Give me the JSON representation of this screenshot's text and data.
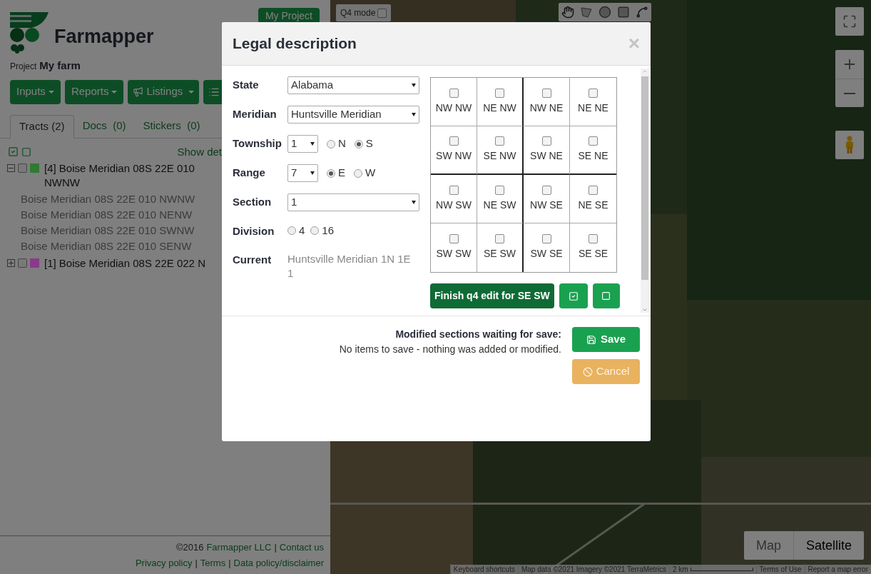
{
  "left_panel": {
    "brand": "Farmapper",
    "my_project_button": "My Project",
    "project_label": "Project",
    "project_name": "My farm",
    "toolbar": [
      {
        "label": "Inputs",
        "kind": "dropdown"
      },
      {
        "label": "Reports",
        "kind": "dropdown"
      },
      {
        "label": "Listings",
        "kind": "icon-dropdown"
      },
      {
        "kind": "icon-only"
      }
    ],
    "tabs": [
      {
        "label": "Tracts (2)",
        "selected": true
      },
      {
        "label": "Docs  (0)",
        "selected": false
      },
      {
        "label": "Stickers  (0)",
        "selected": false
      }
    ],
    "tree_toolbar": {
      "show_details": "Show det"
    },
    "tracts": [
      {
        "label": "[4] Boise Meridian 08S 22E 010 NWNW",
        "expanded": true,
        "checked": false,
        "color": "#2f7a32",
        "children": [
          {
            "label": "Boise Meridian 08S 22E 010 NWNW"
          },
          {
            "label": "Boise Meridian 08S 22E 010 NENW"
          },
          {
            "label": "Boise Meridian 08S 22E 010 SWNW"
          },
          {
            "label": "Boise Meridian 08S 22E 010 SENW"
          }
        ]
      },
      {
        "label": "[1] Boise Meridian 08S 22E 022 N",
        "expanded": false,
        "checked": false,
        "color": "#8a3a8a"
      }
    ],
    "footer": [
      [
        {
          "text": "©2016",
          "kind": "text"
        },
        {
          "text": "Farmapper LLC",
          "kind": "link"
        },
        {
          "text": "|",
          "kind": "text"
        },
        {
          "text": "Contact us",
          "kind": "link"
        }
      ],
      [
        {
          "text": "Privacy policy",
          "kind": "link"
        },
        {
          "text": "|",
          "kind": "text"
        },
        {
          "text": "Terms",
          "kind": "link"
        },
        {
          "text": "|",
          "kind": "text"
        },
        {
          "text": "Data policy/disclaimer",
          "kind": "link"
        }
      ]
    ]
  },
  "map": {
    "q4_mode": {
      "label": "Q4 mode",
      "checked": false
    },
    "map_types": [
      {
        "label": "Map",
        "selected": false
      },
      {
        "label": "Satellite",
        "selected": true
      }
    ],
    "attribution": [
      {
        "text": "Keyboard shortcuts",
        "kind": "link"
      },
      {
        "text": "Map data ©2021 Imagery ©2021 TerraMetrics",
        "kind": "text"
      },
      {
        "text": "2 km",
        "kind": "scale"
      },
      {
        "text": "Terms of Use",
        "kind": "link"
      },
      {
        "text": "Report a map error",
        "kind": "link"
      }
    ]
  },
  "modal": {
    "title": "Legal description",
    "close": "×",
    "fields": [
      {
        "label": "State",
        "kind": "select",
        "value": "Alabama"
      },
      {
        "label": "Meridian",
        "kind": "select",
        "value": "Huntsville Meridian"
      },
      {
        "label": "Township",
        "kind": "select-radios",
        "value": "1",
        "options": [
          {
            "label": "N",
            "selected": false
          },
          {
            "label": "S",
            "selected": true
          }
        ]
      },
      {
        "label": "Range",
        "kind": "select-radios",
        "value": "7",
        "options": [
          {
            "label": "E",
            "selected": true
          },
          {
            "label": "W",
            "selected": false
          }
        ]
      },
      {
        "label": "Section",
        "kind": "select",
        "value": "1"
      },
      {
        "label": "Division",
        "kind": "radios",
        "options": [
          {
            "label": "4",
            "selected": false
          },
          {
            "label": "16",
            "selected": false
          }
        ]
      },
      {
        "label": "Current",
        "kind": "text",
        "value": "Huntsville Meridian 1N 1E 1"
      }
    ],
    "quarters": [
      {
        "label": "NW NW",
        "checked": false
      },
      {
        "label": "NE NW",
        "checked": false
      },
      {
        "label": "NW NE",
        "checked": false
      },
      {
        "label": "NE NE",
        "checked": false
      },
      {
        "label": "SW NW",
        "checked": false
      },
      {
        "label": "SE NW",
        "checked": false
      },
      {
        "label": "SW NE",
        "checked": false
      },
      {
        "label": "SE NE",
        "checked": false
      },
      {
        "label": "NW SW",
        "checked": false
      },
      {
        "label": "NE SW",
        "checked": false
      },
      {
        "label": "NW SE",
        "checked": false
      },
      {
        "label": "NE SE",
        "checked": false
      },
      {
        "label": "SW SW",
        "checked": false
      },
      {
        "label": "SE SW",
        "checked": false
      },
      {
        "label": "SW SE",
        "checked": false
      },
      {
        "label": "SE SE",
        "checked": false
      }
    ],
    "finish_button": "Finish q4 edit for SE SW",
    "status_title": "Modified sections waiting for save:",
    "status_text": "No items to save - nothing was added or modified.",
    "save": "Save",
    "cancel": "Cancel"
  }
}
